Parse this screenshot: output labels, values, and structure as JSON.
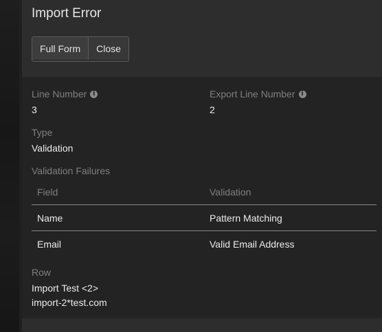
{
  "dialog": {
    "title": "Import Error",
    "buttons": {
      "full_form": "Full Form",
      "close": "Close"
    }
  },
  "details": {
    "line_number": {
      "label": "Line Number",
      "value": "3",
      "icon": "info-icon"
    },
    "export_line_number": {
      "label": "Export Line Number",
      "value": "2",
      "icon": "info-icon"
    },
    "type": {
      "label": "Type",
      "value": "Validation"
    },
    "validation_failures": {
      "label": "Validation Failures",
      "columns": [
        "Field",
        "Validation"
      ],
      "rows": [
        {
          "field": "Name",
          "validation": "Pattern Matching"
        },
        {
          "field": "Email",
          "validation": "Valid Email Address"
        }
      ]
    },
    "row": {
      "label": "Row",
      "lines": [
        "Import Test <2>",
        "import-2*test.com"
      ]
    }
  },
  "colors": {
    "panel_bg": "#232323",
    "header_bg": "#2d2d2d",
    "label": "#7f7f7f",
    "value": "#ececec"
  }
}
